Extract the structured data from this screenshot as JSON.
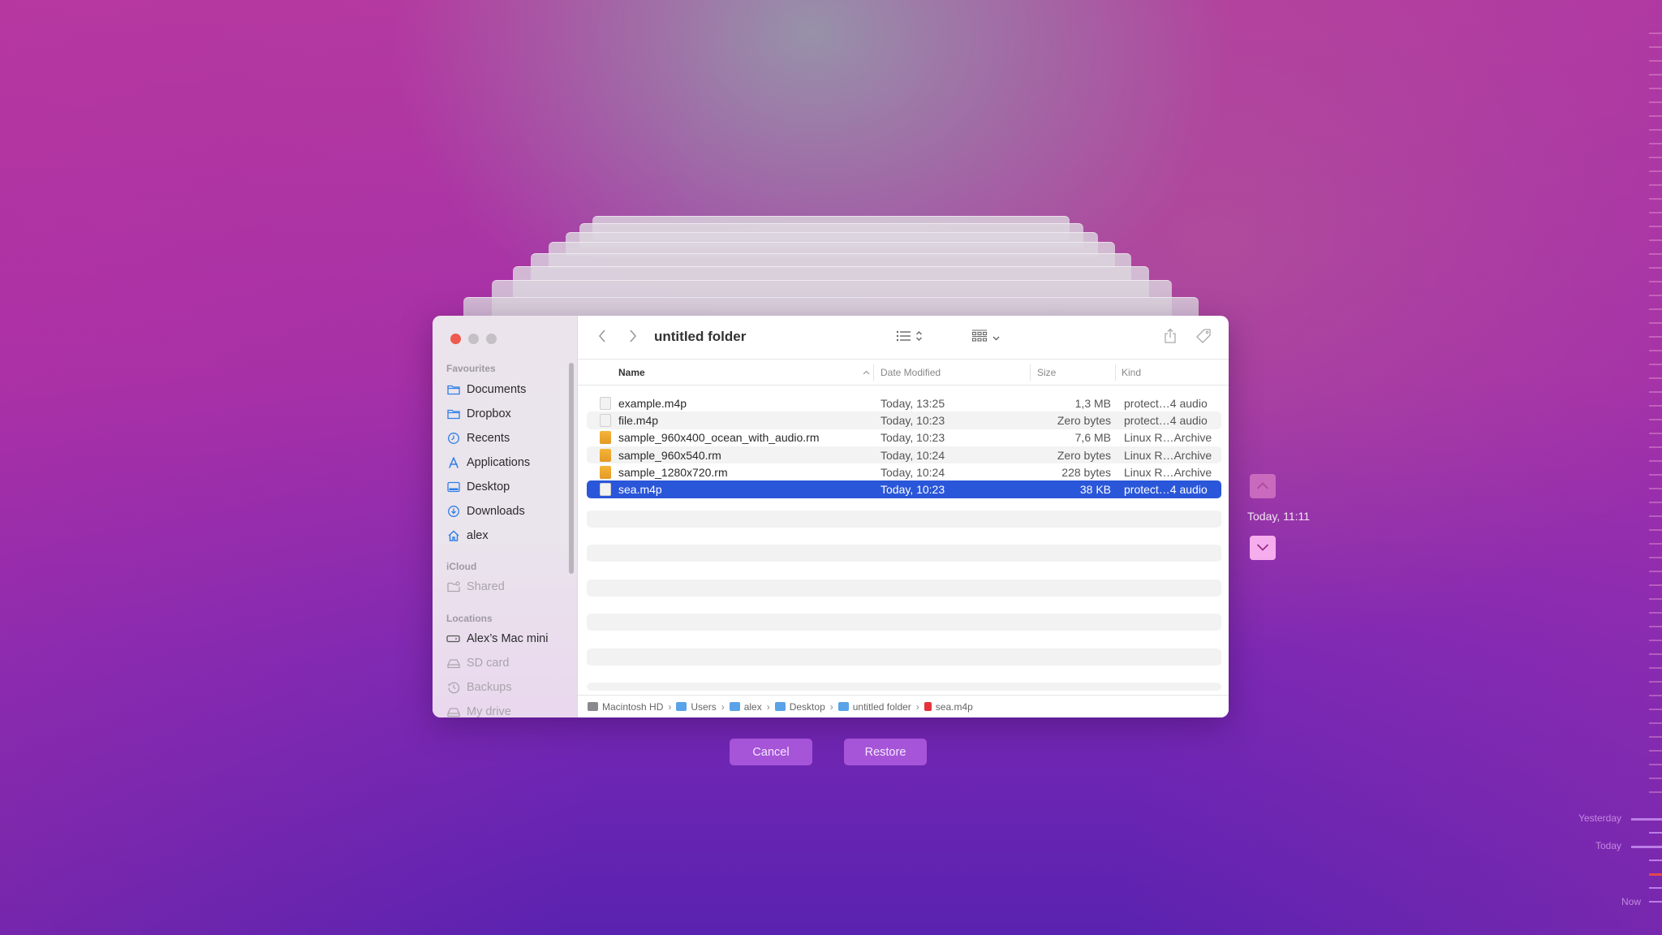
{
  "window": {
    "title": "untitled folder"
  },
  "sidebar": {
    "sections": [
      {
        "label": "Favourites",
        "items": [
          {
            "label": "Documents",
            "icon": "folder-icon",
            "enabled": true
          },
          {
            "label": "Dropbox",
            "icon": "folder-icon",
            "enabled": true
          },
          {
            "label": "Recents",
            "icon": "clock-icon",
            "enabled": true
          },
          {
            "label": "Applications",
            "icon": "applications-icon",
            "enabled": true
          },
          {
            "label": "Desktop",
            "icon": "desktop-icon",
            "enabled": true
          },
          {
            "label": "Downloads",
            "icon": "download-icon",
            "enabled": true
          },
          {
            "label": "alex",
            "icon": "home-icon",
            "enabled": true
          }
        ]
      },
      {
        "label": "iCloud",
        "items": [
          {
            "label": "Shared",
            "icon": "shared-folder-icon",
            "enabled": false
          }
        ]
      },
      {
        "label": "Locations",
        "items": [
          {
            "label": "Alex’s Mac mini",
            "icon": "computer-icon",
            "enabled": true
          },
          {
            "label": "SD card",
            "icon": "drive-icon",
            "enabled": false
          },
          {
            "label": "Backups",
            "icon": "time-machine-icon",
            "enabled": false
          },
          {
            "label": "My drive",
            "icon": "drive-icon",
            "enabled": false
          }
        ]
      }
    ]
  },
  "toolbar": {
    "icons": [
      "back-icon",
      "forward-icon",
      "list-view-icon",
      "group-icon",
      "share-icon",
      "tag-icon",
      "more-icon",
      "overflow-chevron-icon",
      "search-icon"
    ]
  },
  "columns": {
    "name": "Name",
    "date": "Date Modified",
    "size": "Size",
    "kind": "Kind"
  },
  "files": [
    {
      "name": "example.m4p",
      "date": "Today, 13:25",
      "size": "1,3 MB",
      "kind": "protect…4 audio",
      "type": "audio",
      "selected": false
    },
    {
      "name": "file.m4p",
      "date": "Today, 10:23",
      "size": "Zero bytes",
      "kind": "protect…4 audio",
      "type": "audio",
      "selected": false
    },
    {
      "name": "sample_960x400_ocean_with_audio.rm",
      "date": "Today, 10:23",
      "size": "7,6 MB",
      "kind": "Linux R…Archive",
      "type": "rm",
      "selected": false
    },
    {
      "name": "sample_960x540.rm",
      "date": "Today, 10:24",
      "size": "Zero bytes",
      "kind": "Linux R…Archive",
      "type": "rm",
      "selected": false
    },
    {
      "name": "sample_1280x720.rm",
      "date": "Today, 10:24",
      "size": "228 bytes",
      "kind": "Linux R…Archive",
      "type": "rm",
      "selected": false
    },
    {
      "name": "sea.m4p",
      "date": "Today, 10:23",
      "size": "38 KB",
      "kind": "protect…4 audio",
      "type": "audio",
      "selected": true
    }
  ],
  "pathbar": [
    {
      "label": "Macintosh HD",
      "icon": "hard-drive-icon"
    },
    {
      "label": "Users",
      "icon": "folder-icon"
    },
    {
      "label": "alex",
      "icon": "home-folder-icon"
    },
    {
      "label": "Desktop",
      "icon": "folder-icon"
    },
    {
      "label": "untitled folder",
      "icon": "folder-icon"
    },
    {
      "label": "sea.m4p",
      "icon": "audio-file-icon"
    }
  ],
  "actions": {
    "cancel": "Cancel",
    "restore": "Restore"
  },
  "time_machine": {
    "current_snapshot": "Today, 11:11",
    "timeline_labels": [
      "Yesterday",
      "Today",
      "Now"
    ],
    "accent": "#e0484e"
  },
  "colors": {
    "selection": "#2a56d9",
    "close_button": "#ee5a4e",
    "sidebar_icon": "#2f7ee6"
  }
}
